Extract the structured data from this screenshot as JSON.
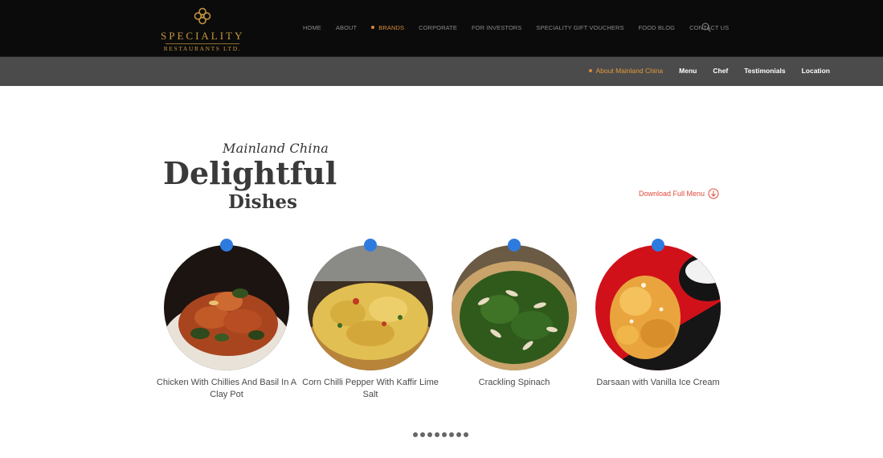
{
  "header": {
    "logo": {
      "line1": "SPECIALITY",
      "line2": "RESTAURANTS LTD.",
      "color": "#c8973f"
    },
    "nav": [
      {
        "label": "HOME",
        "active": false
      },
      {
        "label": "ABOUT",
        "active": false
      },
      {
        "label": "BRANDS",
        "active": true
      },
      {
        "label": "CORPORATE",
        "active": false
      },
      {
        "label": "FOR INVESTORS",
        "active": false
      },
      {
        "label": "SPECIALITY GIFT VOUCHERS",
        "active": false
      },
      {
        "label": "FOOD BLOG",
        "active": false
      },
      {
        "label": "CONTACT US",
        "active": false
      }
    ],
    "search_icon": "search-icon",
    "accent_color": "#d9893a"
  },
  "subnav": {
    "items": [
      {
        "label": "About Mainland China",
        "active": true
      },
      {
        "label": "Menu",
        "active": false
      },
      {
        "label": "Chef",
        "active": false
      },
      {
        "label": "Testimonials",
        "active": false
      },
      {
        "label": "Location",
        "active": false
      }
    ]
  },
  "section": {
    "script_title": "Mainland China",
    "title": "Delightful",
    "subtitle": "Dishes",
    "download_label": "Download Full Menu",
    "download_icon": "arrow-down-circle-icon",
    "download_color": "#e04a3c"
  },
  "dishes": [
    {
      "name": "Chicken With Chillies And Basil In A Clay Pot"
    },
    {
      "name": "Corn Chilli Pepper With Kaffir Lime Salt"
    },
    {
      "name": "Crackling Spinach"
    },
    {
      "name": "Darsaan with Vanilla Ice Cream"
    }
  ],
  "pin_color": "#2e7be0",
  "pagination": {
    "count": 8
  }
}
